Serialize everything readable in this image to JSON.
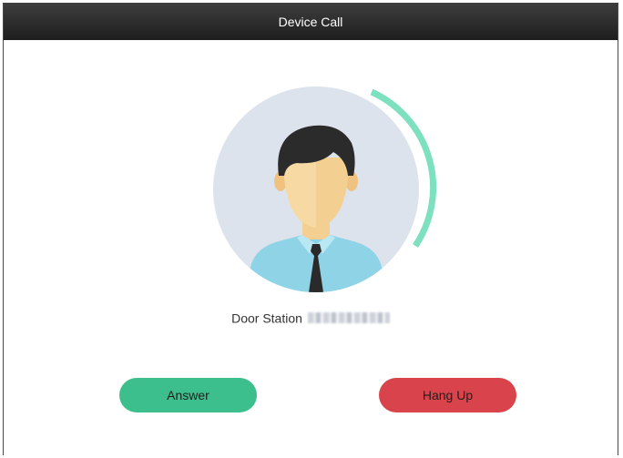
{
  "window": {
    "title": "Device Call"
  },
  "caller": {
    "label": "Door Station"
  },
  "buttons": {
    "answer_label": "Answer",
    "hangup_label": "Hang Up"
  },
  "icons": {
    "avatar": "person-avatar-icon",
    "progress": "call-ring-progress-arc"
  },
  "colors": {
    "answer": "#3cbf8c",
    "hangup": "#d9434b",
    "ring_arc": "#7de0bf",
    "titlebar": "#2a2a2a"
  }
}
